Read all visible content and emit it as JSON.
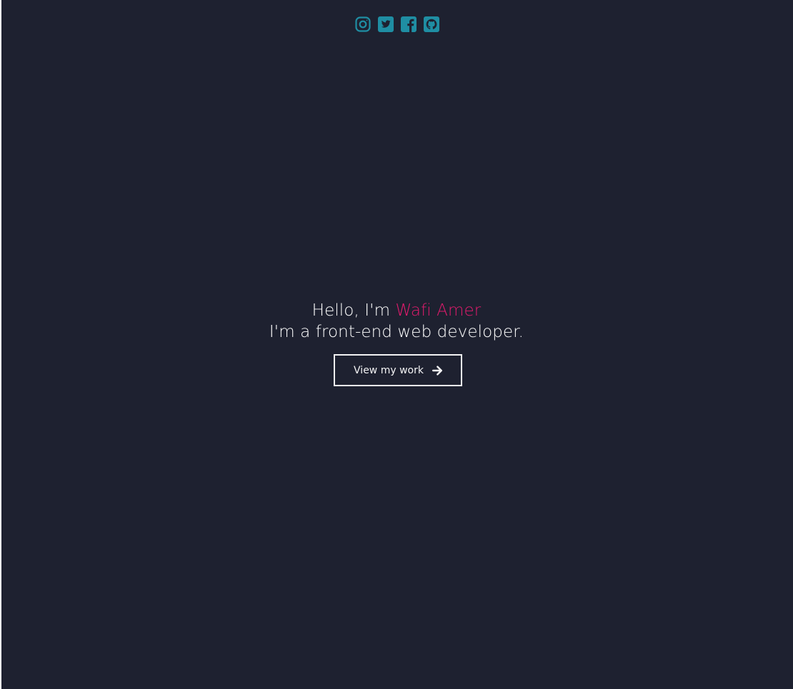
{
  "social": [
    {
      "icon": "instagram-icon"
    },
    {
      "icon": "twitter-icon"
    },
    {
      "icon": "facebook-icon"
    },
    {
      "icon": "github-icon"
    }
  ],
  "hero": {
    "greeting_prefix": "Hello, I'm ",
    "name": "Wafi Amer",
    "tagline": "I'm a front-end web developer."
  },
  "cta": {
    "label": "View my work",
    "icon": "arrow-right-icon"
  },
  "colors": {
    "background": "#1e2130",
    "accent_name": "#e31b6d",
    "social_icons": "#1f8ea3",
    "text": "#ffffff"
  }
}
